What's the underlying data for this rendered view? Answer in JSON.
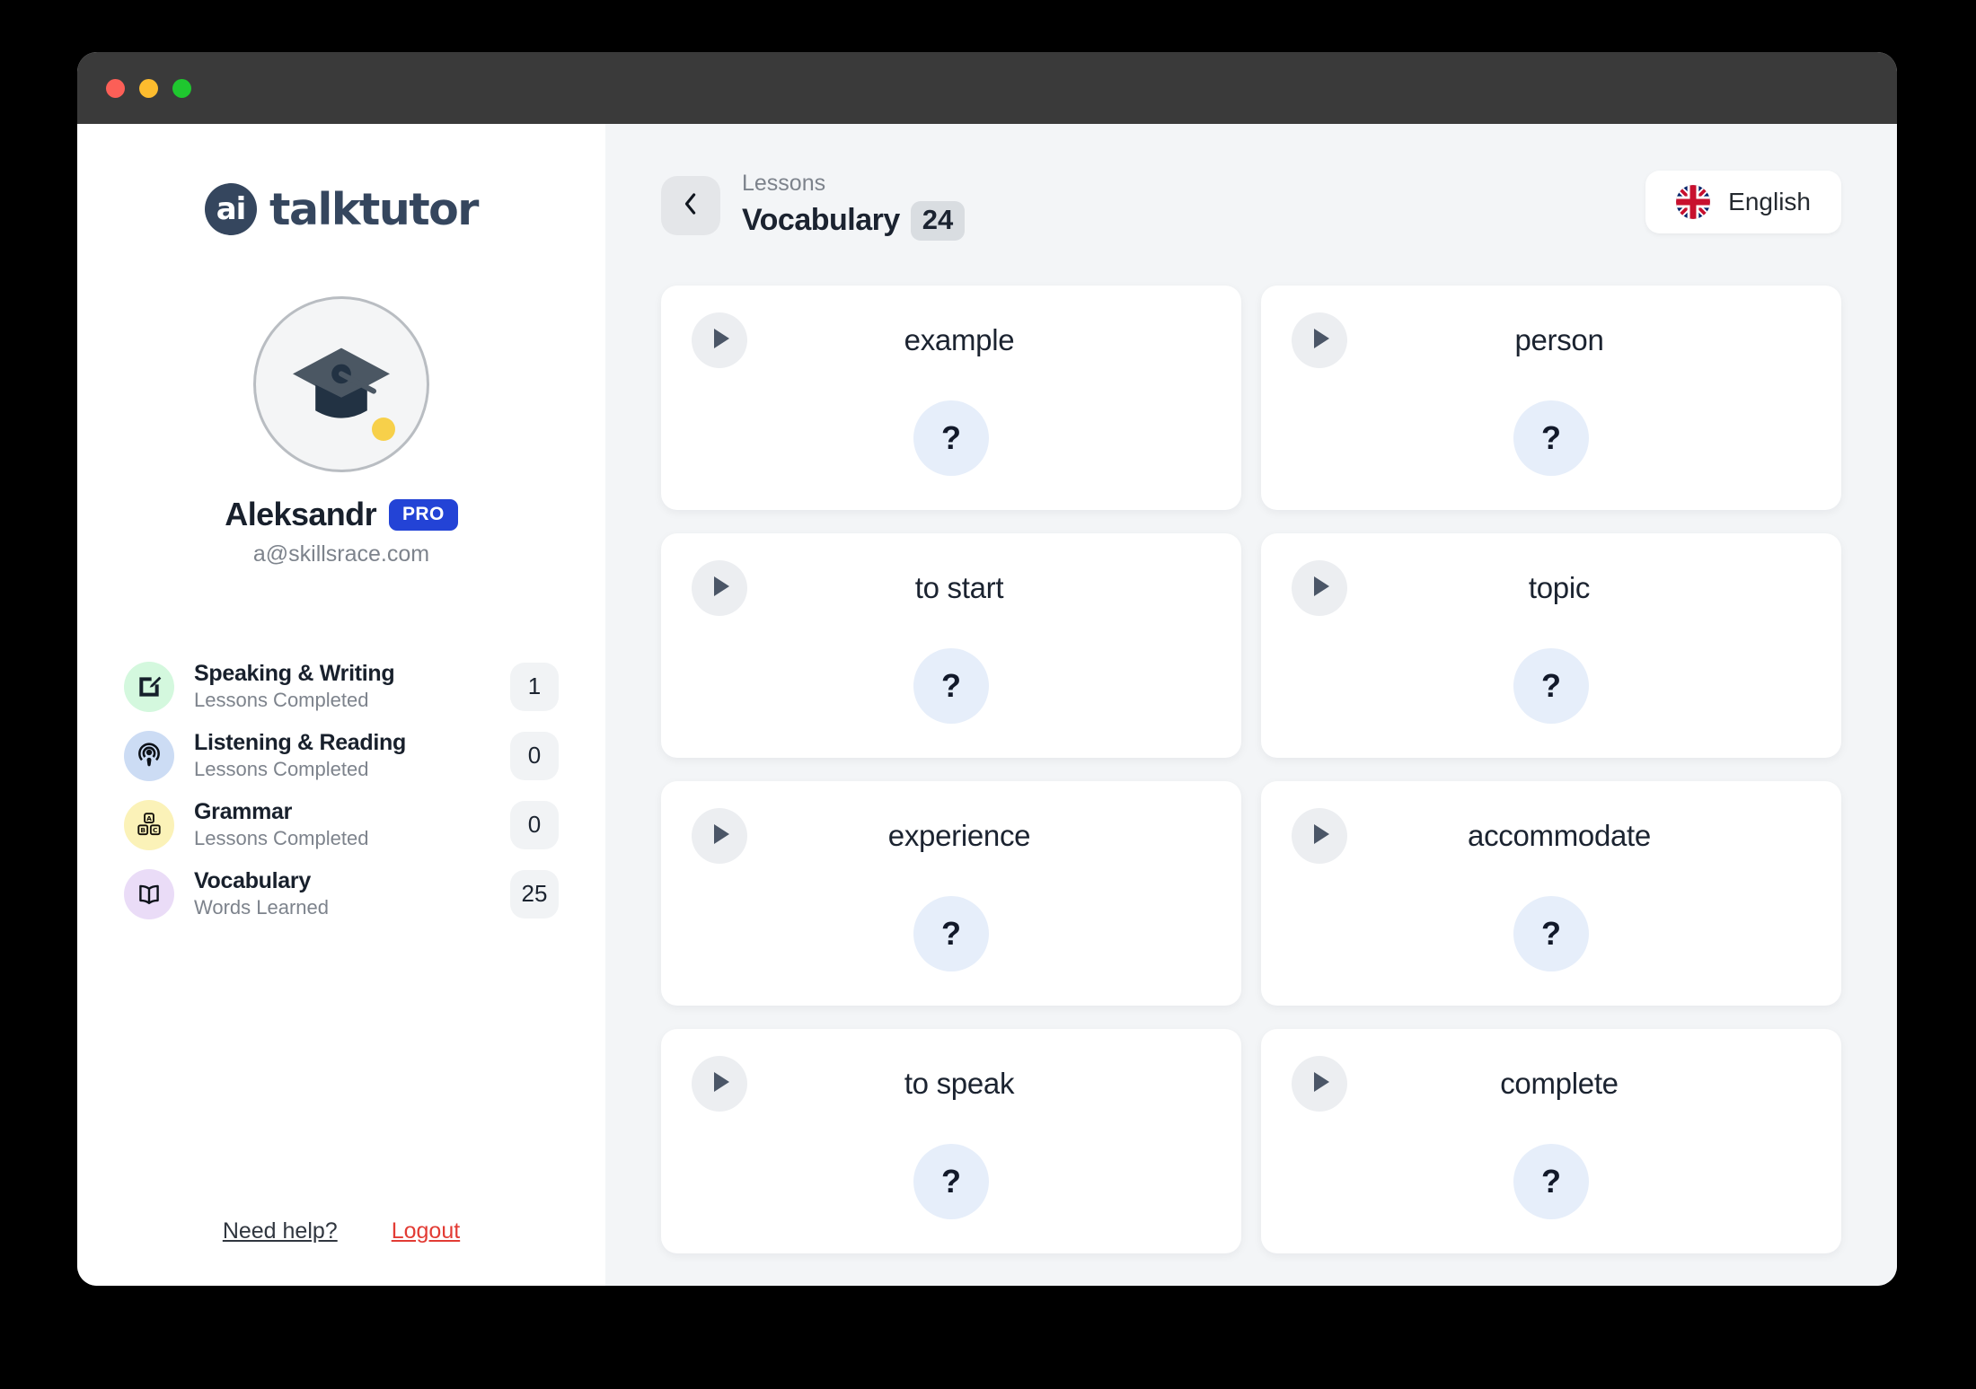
{
  "window": {
    "traffic_lights": [
      "close",
      "minimize",
      "maximize"
    ]
  },
  "sidebar": {
    "logo": {
      "mark": "ai",
      "text": "talktutor"
    },
    "avatar": {
      "icon": "graduation-cap-icon",
      "tassel_color": "#f7d04a"
    },
    "user": {
      "name": "Aleksandr",
      "badge": "PRO",
      "email": "a@skillsrace.com"
    },
    "stats": [
      {
        "icon": "pencil-square-icon",
        "title": "Speaking & Writing",
        "subtitle": "Lessons Completed",
        "count": "1",
        "color": "#d4f8de"
      },
      {
        "icon": "podcast-icon",
        "title": "Listening & Reading",
        "subtitle": "Lessons Completed",
        "count": "0",
        "color": "#ccdcf4"
      },
      {
        "icon": "abc-blocks-icon",
        "title": "Grammar",
        "subtitle": "Lessons Completed",
        "count": "0",
        "color": "#fbf2b8"
      },
      {
        "icon": "open-book-icon",
        "title": "Vocabulary",
        "subtitle": "Words Learned",
        "count": "25",
        "color": "#eadcf7"
      }
    ],
    "footer": {
      "help_label": "Need help?",
      "logout_label": "Logout",
      "logout_color": "#e23b34"
    }
  },
  "main": {
    "breadcrumb": {
      "parent": "Lessons",
      "title": "Vocabulary",
      "count": "24"
    },
    "back_button": "chevron-left-icon",
    "language": {
      "label": "English",
      "flag": "uk-flag-icon"
    },
    "cards": [
      {
        "word": "example",
        "answer": "?"
      },
      {
        "word": "person",
        "answer": "?"
      },
      {
        "word": "to start",
        "answer": "?"
      },
      {
        "word": "topic",
        "answer": "?"
      },
      {
        "word": "experience",
        "answer": "?"
      },
      {
        "word": "accommodate",
        "answer": "?"
      },
      {
        "word": "to speak",
        "answer": "?"
      },
      {
        "word": "complete",
        "answer": "?"
      }
    ]
  },
  "colors": {
    "brand": "#35465e",
    "accent": "#2343d6",
    "main_bg": "#f3f5f7",
    "answer_bubble": "#e6eefa"
  }
}
